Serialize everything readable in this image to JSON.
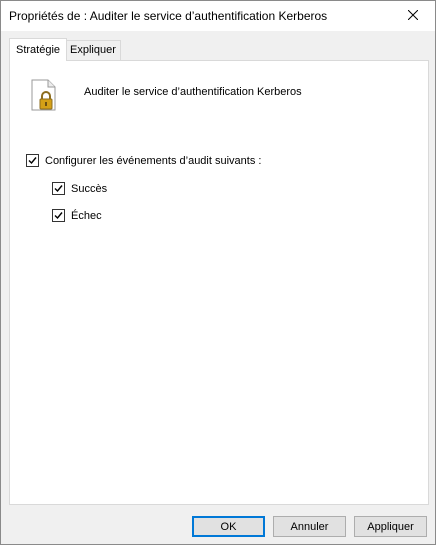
{
  "window": {
    "title": "Propriétés de : Auditer le service d’authentification Kerberos",
    "close_icon": "close-icon"
  },
  "tabs": [
    {
      "label": "Stratégie",
      "active": true
    },
    {
      "label": "Expliquer",
      "active": false
    }
  ],
  "policy": {
    "icon": "document-lock-icon",
    "name": "Auditer le service d’authentification Kerberos"
  },
  "options": {
    "configure": {
      "label": "Configurer les événements d’audit suivants :",
      "checked": true
    },
    "succes": {
      "label": "Succès",
      "checked": true
    },
    "echec": {
      "label": "Échec",
      "checked": true
    }
  },
  "buttons": {
    "ok": "OK",
    "annuler": "Annuler",
    "appliquer": "Appliquer"
  },
  "colors": {
    "accent": "#0078d7",
    "panel_bg": "#ffffff",
    "window_bg": "#f0f0f0",
    "lock_gold": "#d4a017"
  }
}
